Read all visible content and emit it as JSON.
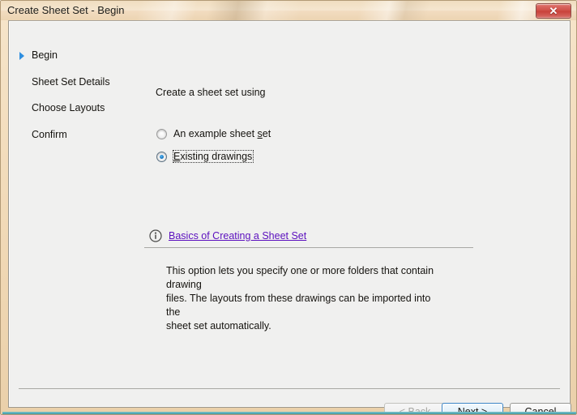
{
  "window": {
    "title": "Create Sheet Set - Begin",
    "close_label": "✕",
    "close_icon": "close-icon"
  },
  "sidebar": {
    "items": [
      {
        "label": "Begin",
        "active": true
      },
      {
        "label": "Sheet Set Details",
        "active": false
      },
      {
        "label": "Choose Layouts",
        "active": false
      },
      {
        "label": "Confirm",
        "active": false
      }
    ]
  },
  "main": {
    "prompt": "Create a sheet set using",
    "options": [
      {
        "label_prefix": "An example sheet ",
        "accel": "s",
        "label_suffix": "et",
        "selected": false,
        "focused": false
      },
      {
        "label_prefix": "",
        "accel": "E",
        "label_suffix": "xisting drawings",
        "selected": true,
        "focused": true
      }
    ],
    "help_link": "Basics of Creating a Sheet Set",
    "info_icon": "info-icon",
    "description": "This option lets you specify one or more folders that contain drawing\nfiles.  The layouts from these drawings can be imported into the\nsheet set automatically."
  },
  "footer": {
    "back": {
      "prefix": "< ",
      "accel": "B",
      "suffix": "ack",
      "disabled": true
    },
    "next": {
      "prefix": "",
      "accel": "N",
      "suffix": "ext >",
      "default": true
    },
    "cancel": {
      "label": "Cancel"
    }
  },
  "colors": {
    "frame": "#f0ddc0",
    "client_bg": "#f0f0ef",
    "link": "#5b0fbe",
    "accent_blue": "#2f8fe0",
    "close_red": "#cf4f47",
    "teal_edge": "#55a9b4"
  }
}
